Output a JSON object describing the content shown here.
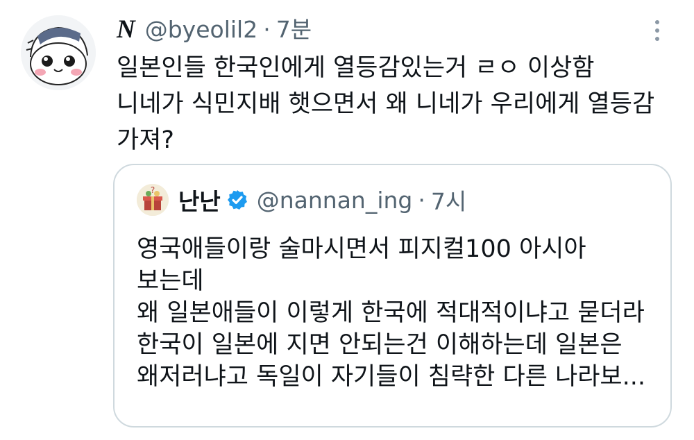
{
  "tweet": {
    "author_name": "N",
    "handle": "@byeolil2",
    "separator": "·",
    "time": "7분",
    "lines": [
      "일본인들 한국인에게 열등감있는거 ㄹㅇ 이상함",
      "니네가 식민지배 햇으면서 왜 니네가 우리에게 열등감",
      "가져?"
    ]
  },
  "quote": {
    "author_name": "난난",
    "handle": "@nannan_ing",
    "separator": "·",
    "time": "7시",
    "lines": [
      "영국애들이랑 술마시면서 피지컬100 아시아",
      "보는데",
      "왜 일본애들이 이렇게 한국에 적대적이냐고 묻더라",
      "한국이 일본에 지면 안되는건 이해하는데 일본은",
      "왜저러냐고 독일이 자기들이 침략한 다른 나라보..."
    ]
  },
  "icons": {
    "more": "more-dots-icon",
    "verified": "verified-badge-icon"
  },
  "colors": {
    "text": "#0f1419",
    "secondary": "#536471",
    "border": "#cfd9de",
    "verified": "#1d9bf0"
  }
}
